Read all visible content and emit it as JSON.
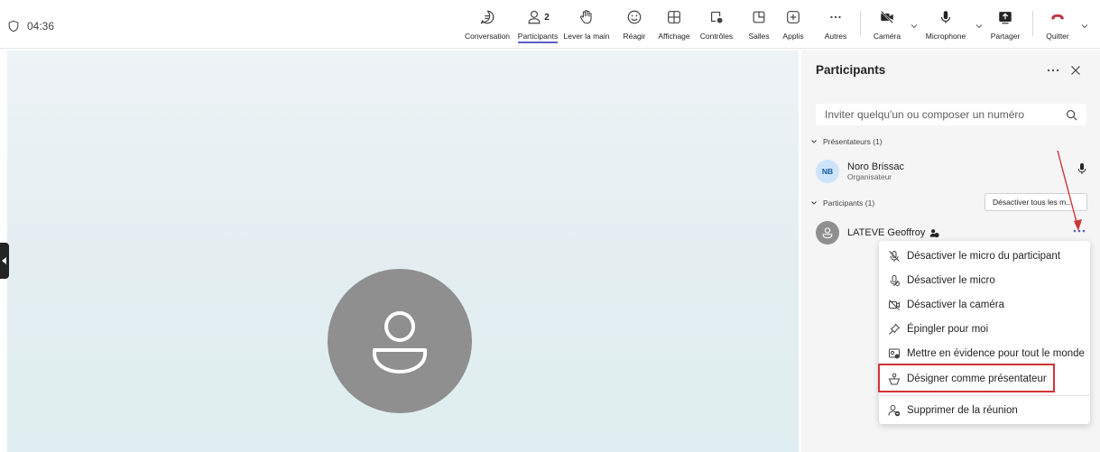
{
  "topbar": {
    "timer": "04:36",
    "participants_count": "2",
    "buttons": {
      "conversation": "Conversation",
      "participants": "Participants",
      "raise_hand": "Lever la main",
      "react": "Réagir",
      "view": "Affichage",
      "controls": "Contrôles",
      "rooms": "Salles",
      "apps": "Applis",
      "more": "Autres",
      "camera": "Caméra",
      "microphone": "Microphone",
      "share": "Partager",
      "leave": "Quitter"
    }
  },
  "panel": {
    "title": "Participants",
    "search_placeholder": "Inviter quelqu'un ou composer un numéro",
    "presenters_section": "Présentateurs (1)",
    "participants_section": "Participants (1)",
    "mute_all": "Désactiver tous les m...",
    "presenter": {
      "initials": "NB",
      "name": "Noro Brissac",
      "role": "Organisateur"
    },
    "participant": {
      "name": "LATEVE Geoffroy"
    }
  },
  "context_menu": {
    "items": [
      "Désactiver le micro du participant",
      "Désactiver le micro",
      "Désactiver la caméra",
      "Épingler pour moi",
      "Mettre en évidence pour tout le monde",
      "Désigner comme présentateur",
      "Supprimer de la réunion"
    ]
  },
  "colors": {
    "accent": "#5b5fc7",
    "leave": "#c4314b",
    "highlight": "#d13438"
  }
}
